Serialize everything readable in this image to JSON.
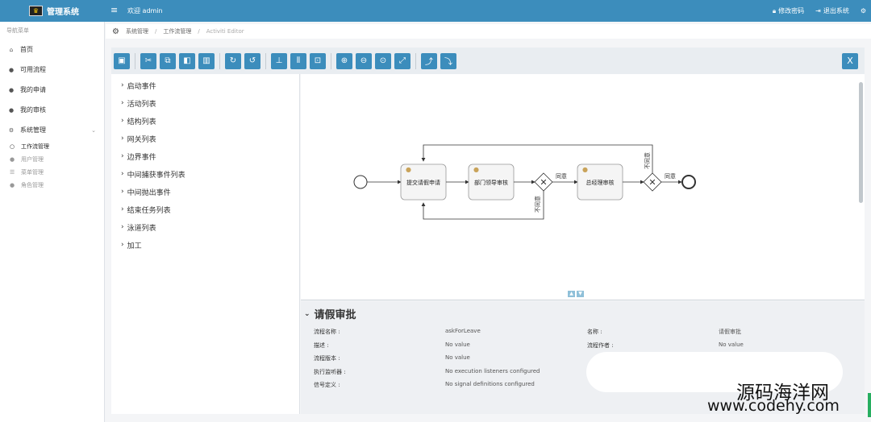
{
  "header": {
    "brand": "管理系统",
    "welcome": "欢迎 admin",
    "change_password": "修改密码",
    "logout": "退出系统",
    "brand_color": "#3c8dbc"
  },
  "sidebar": {
    "header": "导航菜单",
    "items": [
      {
        "label": "首页",
        "icon": "home-icon"
      },
      {
        "label": "可用流程",
        "icon": "user-icon"
      },
      {
        "label": "我的申请",
        "icon": "user-icon"
      },
      {
        "label": "我的审核",
        "icon": "user-icon"
      },
      {
        "label": "系统管理",
        "icon": "gear-icon"
      }
    ],
    "sub_items": [
      {
        "label": "工作流管理",
        "icon": "circle-icon"
      },
      {
        "label": "用户管理",
        "icon": "user-icon"
      },
      {
        "label": "菜单管理",
        "icon": "list-icon"
      },
      {
        "label": "角色管理",
        "icon": "user-icon"
      }
    ]
  },
  "breadcrumb": {
    "item1": "系统管理",
    "item2": "工作流管理",
    "item3": "Activiti Editor"
  },
  "toolbar": {
    "close_label": "X"
  },
  "palette": {
    "items": [
      "启动事件",
      "活动列表",
      "结构列表",
      "网关列表",
      "边界事件",
      "中间捕获事件列表",
      "中间抛出事件",
      "结束任务列表",
      "泳道列表",
      "加工"
    ]
  },
  "diagram": {
    "task1": "提交请假申请",
    "task2": "部门领导审核",
    "task3": "总经理审核",
    "flow_agree1": "同意",
    "flow_reject1": "不同意",
    "flow_agree2": "同意",
    "flow_reject2": "不同意"
  },
  "properties": {
    "title": "请假审批",
    "rows": [
      {
        "label": "流程名称 :",
        "value": "askForLeave",
        "label2": "名称 :",
        "value2": "请假审批"
      },
      {
        "label": "描述 :",
        "value": "No value",
        "label2": "流程作者 :",
        "value2": "No value"
      },
      {
        "label": "流程版本 :",
        "value": "No value",
        "label2": "",
        "value2": ""
      },
      {
        "label": "执行监听器 :",
        "value": "No execution listeners configured",
        "label2": "",
        "value2": ""
      },
      {
        "label": "信号定义 :",
        "value": "No signal definitions configured",
        "label2": "",
        "value2": ""
      }
    ]
  },
  "watermark": {
    "line1": "源码海洋网",
    "line2": "www.codehy.com"
  }
}
